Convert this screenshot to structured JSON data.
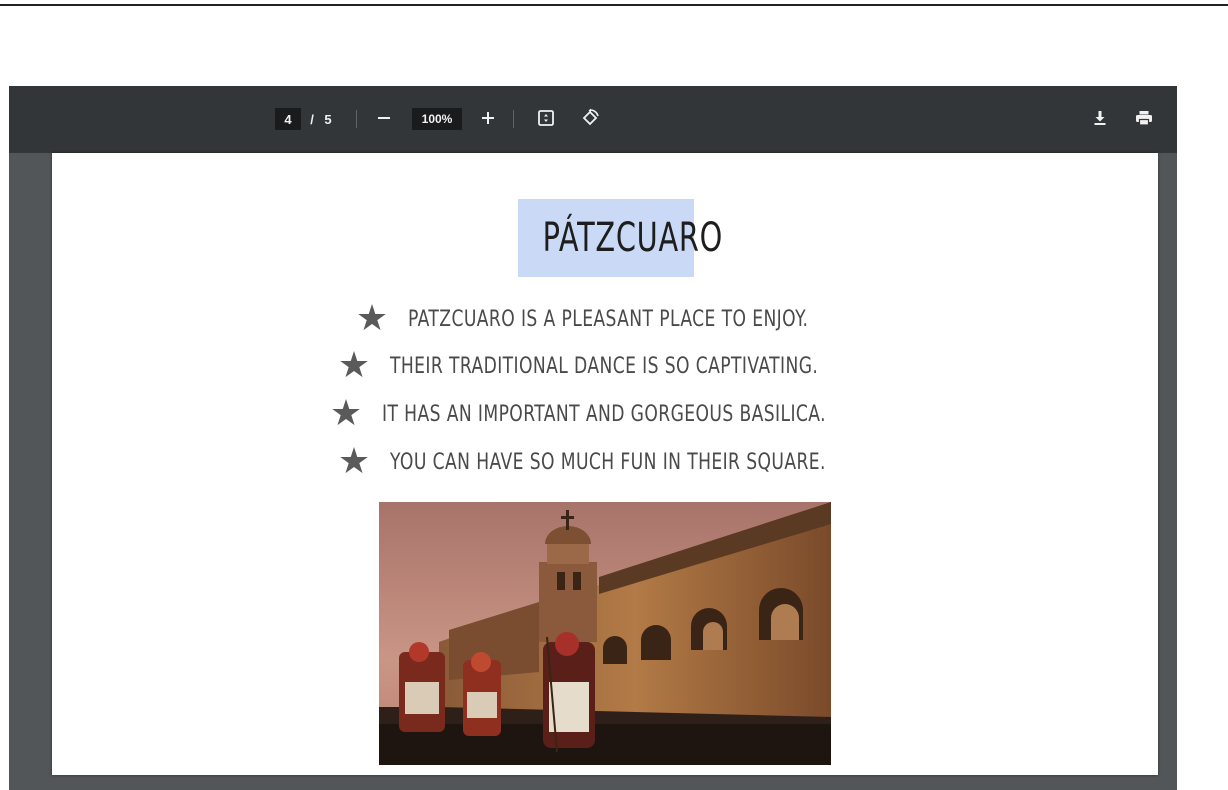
{
  "toolbar": {
    "page_current": "4",
    "page_separator": "/",
    "page_total": "5",
    "zoom_level": "100%",
    "icons": [
      "minus-icon",
      "plus-icon",
      "fit-page-icon",
      "rotate-icon",
      "download-icon",
      "print-icon"
    ]
  },
  "document": {
    "title": "PÁTZCUARO",
    "bullets": [
      "PATZCUARO IS A PLEASANT PLACE TO ENJOY.",
      "THEIR TRADITIONAL DANCE IS SO CAPTIVATING.",
      "IT HAS AN IMPORTANT AND GORGEOUS BASILICA.",
      "YOU CAN HAVE SO MUCH FUN IN THEIR SQUARE."
    ],
    "bullet_icon": "star-icon",
    "title_highlight_color": "#c9d9f6"
  },
  "colors": {
    "toolbar_bg": "#323639",
    "viewer_bg": "#525659"
  }
}
